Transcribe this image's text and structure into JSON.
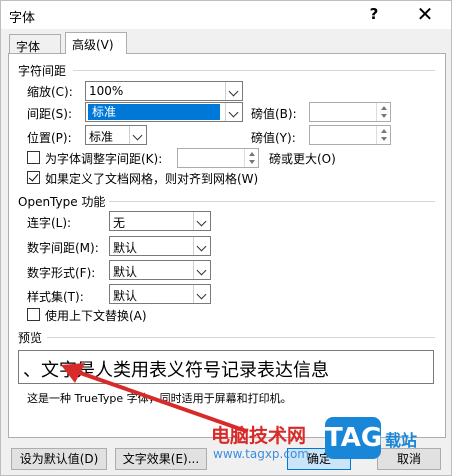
{
  "window": {
    "title": "字体",
    "help_label": "?",
    "close_label": "✕"
  },
  "tabs": [
    {
      "label": "字体(N)"
    },
    {
      "label": "高级(V)"
    }
  ],
  "char_spacing": {
    "group_label": "字符间距",
    "scale_label": "缩放(C):",
    "scale_value": "100%",
    "spacing_label": "间距(S):",
    "spacing_value": "标准",
    "spacing_amount_label": "磅值(B):",
    "spacing_amount_value": "",
    "position_label": "位置(P):",
    "position_value": "标准",
    "position_amount_label": "磅值(Y):",
    "position_amount_value": "",
    "kerning_label": "为字体调整字间距(K):",
    "kerning_value": "",
    "kerning_suffix": "磅或更大(O)",
    "kerning_checked": false,
    "grid_label": "如果定义了文档网格，则对齐到网格(W)",
    "grid_checked": true
  },
  "opentype": {
    "group_label": "OpenType 功能",
    "ligatures_label": "连字(L):",
    "ligatures_value": "无",
    "num_spacing_label": "数字间距(M):",
    "num_spacing_value": "默认",
    "num_forms_label": "数字形式(F):",
    "num_forms_value": "默认",
    "stylistic_label": "样式集(T):",
    "stylistic_value": "默认",
    "contextual_label": "使用上下文替换(A)",
    "contextual_checked": false
  },
  "preview": {
    "group_label": "预览",
    "sample_text": "、文字是人类用表义符号记录表达信息",
    "note": "这是一种 TrueType 字体，同时适用于屏幕和打印机。"
  },
  "buttons": {
    "set_default": "设为默认值(D)",
    "text_effects": "文字效果(E)...",
    "ok": "确定",
    "cancel": "取消"
  },
  "watermark": {
    "site_name": "电脑技术网",
    "url": "www.tagxp.com",
    "badge": "TAG",
    "suffix": "载站"
  },
  "colors": {
    "selection": "#0078d7",
    "watermark_red": "#d92a2a",
    "badge_blue": "#1a86d8"
  }
}
